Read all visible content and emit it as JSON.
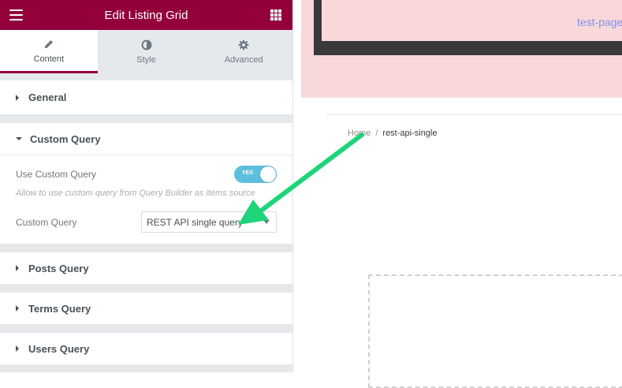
{
  "header": {
    "title": "Edit Listing Grid",
    "menu_icon": "hamburger-icon",
    "apps_icon": "grid-icon"
  },
  "tabs": [
    {
      "label": "Content",
      "icon": "pencil-icon",
      "active": true
    },
    {
      "label": "Style",
      "icon": "half-circle-icon",
      "active": false
    },
    {
      "label": "Advanced",
      "icon": "gear-icon",
      "active": false
    }
  ],
  "sections": {
    "general": "General",
    "custom_query": "Custom Query",
    "posts_query": "Posts Query",
    "terms_query": "Terms Query",
    "users_query": "Users Query"
  },
  "custom_query": {
    "use_label": "Use Custom Query",
    "toggle_text": "YES",
    "toggle_on": true,
    "description": "Allow to use custom query from Query Builder as items source",
    "query_label": "Custom Query",
    "query_value": "REST API single query"
  },
  "preview": {
    "nav_link": "test-page",
    "breadcrumb_home": "Home",
    "breadcrumb_sep": "/",
    "breadcrumb_current": "rest-api-single"
  },
  "colors": {
    "brand": "#93003c",
    "toggle": "#5bc0de",
    "arrow": "#1ed47a"
  }
}
